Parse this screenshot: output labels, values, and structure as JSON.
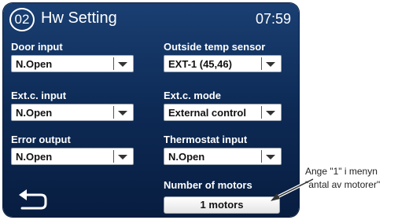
{
  "header": {
    "screen_number": "02",
    "title": "Hw Setting",
    "time": "07:59"
  },
  "left_column": [
    {
      "label": "Door input",
      "value": "N.Open"
    },
    {
      "label": "Ext.c. input",
      "value": "N.Open"
    },
    {
      "label": "Error output",
      "value": "N.Open"
    }
  ],
  "right_column": [
    {
      "label": "Outside temp sensor",
      "value": "EXT-1 (45,46)"
    },
    {
      "label": "Ext.c. mode",
      "value": "External control"
    },
    {
      "label": "Thermostat input",
      "value": "N.Open"
    }
  ],
  "motors": {
    "label": "Number of motors",
    "value": "1 motors"
  },
  "annotation": {
    "line1": "Ange \"1\" i menyn",
    "line2": "\"antal av motorer\""
  },
  "icons": {
    "back": "back-arrow-icon",
    "dropdown": "chevron-down-icon"
  },
  "colors": {
    "screen_background": "#0d2a55",
    "field_background": "#ffffff",
    "label_text": "#ffffff"
  }
}
